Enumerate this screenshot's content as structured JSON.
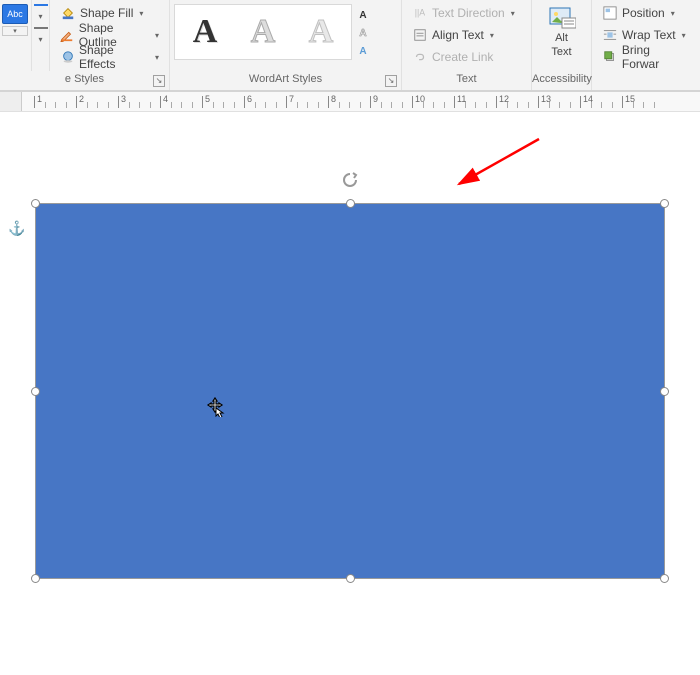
{
  "ribbon": {
    "groups": {
      "shape_styles": {
        "label": "e Styles",
        "swatch_text": "Abc"
      },
      "shape_fill": {
        "fill": "Shape Fill",
        "outline": "Shape Outline",
        "effects": "Shape Effects"
      },
      "wordart": {
        "label": "WordArt Styles",
        "glyph": "A"
      },
      "text": {
        "label": "Text",
        "direction": "Text Direction",
        "align": "Align Text",
        "create_link": "Create Link"
      },
      "accessibility": {
        "label": "Accessibility",
        "alt1": "Alt",
        "alt2": "Text"
      },
      "arrange": {
        "position": "Position",
        "wrap": "Wrap Text",
        "bring_forward": "Bring Forwar"
      }
    }
  },
  "ruler": {
    "ticks": [
      1,
      2,
      3,
      4,
      5,
      6,
      7,
      8,
      9,
      10,
      11,
      12,
      13,
      14,
      15
    ]
  },
  "shape": {
    "fill": "#4776c5",
    "border": "#3560a6"
  },
  "cursor": {
    "type": "move"
  },
  "annotation": {
    "arrow_color": "#ff0000"
  }
}
